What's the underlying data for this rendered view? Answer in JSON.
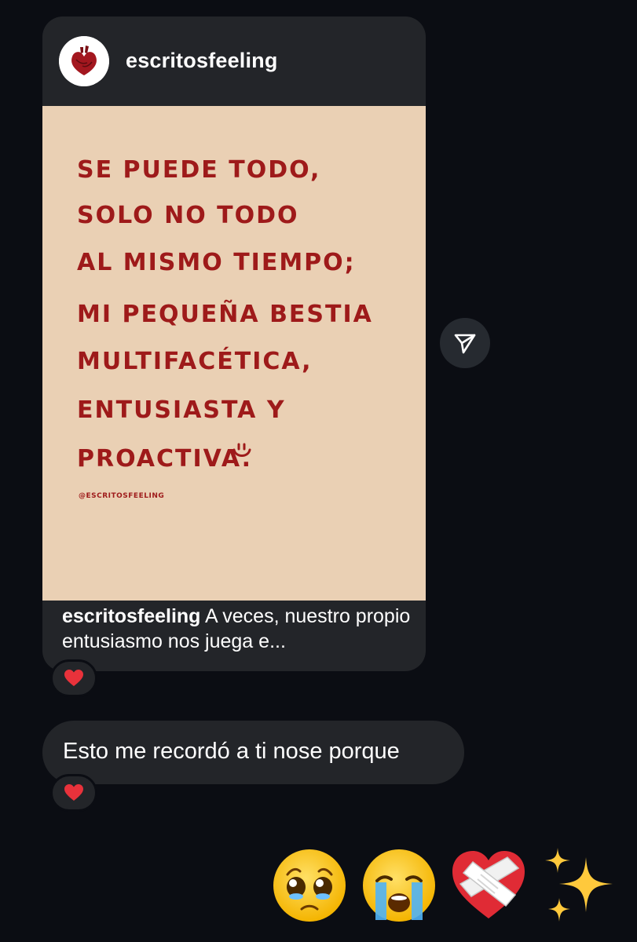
{
  "shared_post": {
    "username": "escritosfeeling",
    "image_text_lines": [
      "SE PUEDE TODO,",
      "SOLO NO TODO",
      "AL MISMO TIEMPO;",
      "MI PEQUEÑA BESTIA",
      "MULTIFACÉTICA,",
      "ENTUSIASTA Y",
      "PROACTIVA."
    ],
    "watermark": "@ESCRITOSFEELING",
    "caption_username": "escritosfeeling",
    "caption_text": " A veces, nuestro propio entusiasmo nos juega e...",
    "reaction": "❤️"
  },
  "share_button": {
    "icon": "paper-plane-icon"
  },
  "message": {
    "text": "Esto me recordó a ti nose porque",
    "reaction": "❤️"
  },
  "reply_emojis": [
    "🥹",
    "😭",
    "❤️‍🩹",
    "✨"
  ],
  "colors": {
    "background": "#0b0d13",
    "bubble": "#232529",
    "quote_ink": "#9e1a1a",
    "quote_paper": "#ead0b4",
    "heart": "#e8323b"
  }
}
